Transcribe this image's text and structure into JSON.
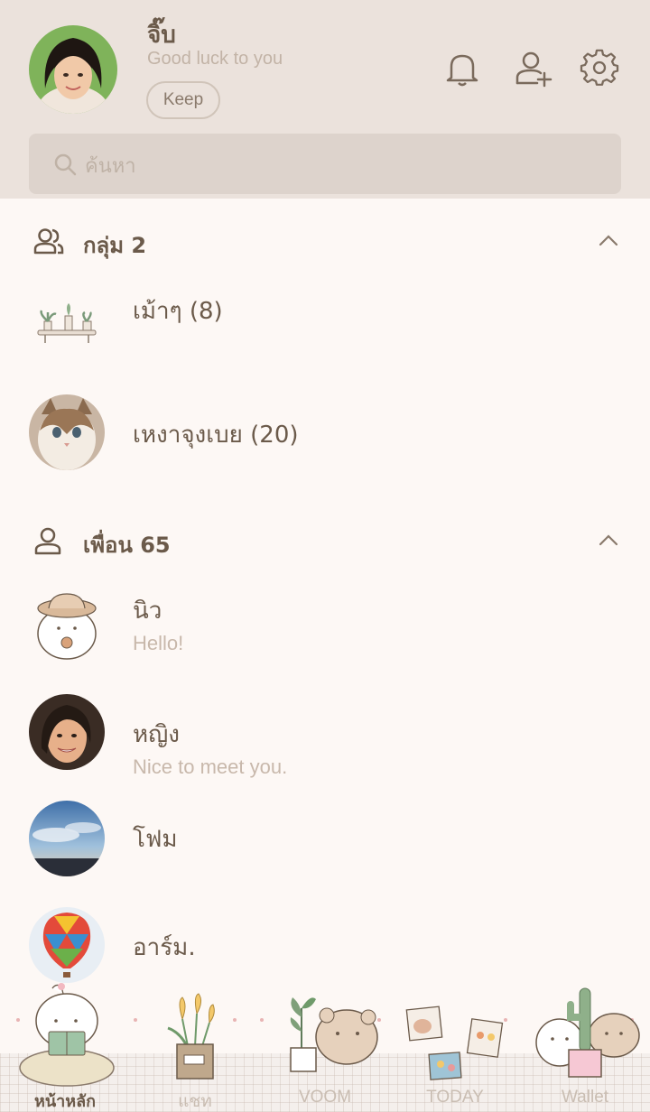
{
  "profile": {
    "name": "จิ๊บ",
    "status": "Good luck to you",
    "keep_label": "Keep"
  },
  "header_icons": [
    "bell-icon",
    "add-friend-icon",
    "gear-icon"
  ],
  "search": {
    "placeholder": "ค้นหา"
  },
  "groups": {
    "title": "กลุ่ม 2",
    "items": [
      {
        "name": "เม้าๆ (8)"
      },
      {
        "name": "เหงาจุงเบย (20)"
      }
    ]
  },
  "friends": {
    "title": "เพื่อน 65",
    "items": [
      {
        "name": "นิว",
        "status": "Hello!"
      },
      {
        "name": "หญิง",
        "status": "Nice to meet you."
      },
      {
        "name": "โฟม",
        "status": ""
      },
      {
        "name": "อาร์ม.",
        "status": ""
      }
    ]
  },
  "tabs": [
    {
      "label": "หน้าหลัก",
      "active": true
    },
    {
      "label": "แชท",
      "active": false
    },
    {
      "label": "VOOM",
      "active": false
    },
    {
      "label": "TODAY",
      "active": false
    },
    {
      "label": "Wallet",
      "active": false
    }
  ],
  "colors": {
    "header_bg": "#ebe2dc",
    "body_bg": "#fdf8f5",
    "text": "#6b5a4a",
    "muted": "#c8b8ab"
  }
}
